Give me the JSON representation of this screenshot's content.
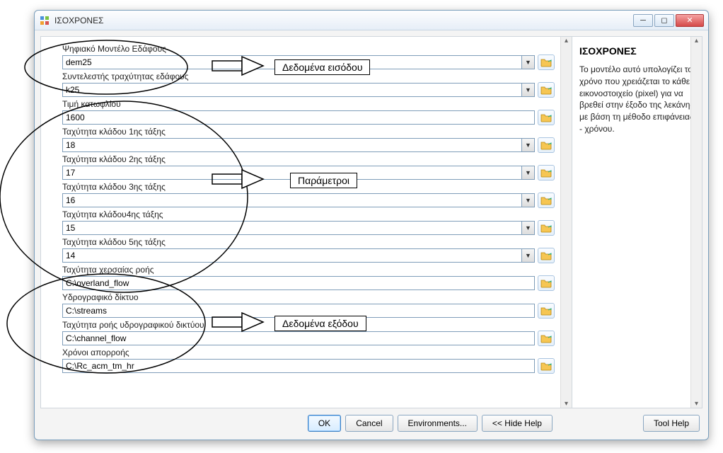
{
  "window": {
    "title": "ΙΣΟΧΡΟΝΕΣ"
  },
  "fields": [
    {
      "label": "Ψηφιακό Μοντέλο Εδάφους",
      "value": "dem25",
      "combo": true
    },
    {
      "label": "Συντελεστής τραχύτητας εδάφους",
      "value": "k25",
      "combo": true
    },
    {
      "label": "Τιμή κατωφλίου",
      "value": "1600",
      "combo": false
    },
    {
      "label": "Ταχύτητα κλάδου 1ης τάξης",
      "value": "18",
      "combo": true
    },
    {
      "label": "Ταχύτητα κλάδου 2ης τάξης",
      "value": "17",
      "combo": true
    },
    {
      "label": "Ταχύτητα κλάδου 3ης τάξης",
      "value": "16",
      "combo": true
    },
    {
      "label": "Ταχύτητα κλάδου4ης τάξης",
      "value": "15",
      "combo": true
    },
    {
      "label": "Ταχύτητα κλάδου 5ης τάξης",
      "value": "14",
      "combo": true
    },
    {
      "label": "Ταχύτητα χερσαίας ροής",
      "value": "C:\\overland_flow",
      "combo": false
    },
    {
      "label": "Υδρογραφικό δίκτυο",
      "value": "C:\\streams",
      "combo": false
    },
    {
      "label": "Ταχύτητα ροής υδρογραφικού δικτύου",
      "value": "C:\\channel_flow",
      "combo": false
    },
    {
      "label": "Χρόνοι απορροής",
      "value": "C:\\Rc_acm_tm_hr",
      "combo": false
    }
  ],
  "help": {
    "title": "ΙΣΟΧΡΟΝΕΣ",
    "body": "Το μοντέλο αυτό υπολογίζει το χρόνο που χρειάζεται το κάθε εικονοστοιχείο (pixel) για να βρεθεί στην έξοδο της λεκάνης με βάση τη μέθοδο επιφάνειας - χρόνου."
  },
  "buttons": {
    "ok": "OK",
    "cancel": "Cancel",
    "environments": "Environments...",
    "hidehelp": "<< Hide Help",
    "toolhelp": "Tool Help"
  },
  "annotations": {
    "input": "Δεδομένα εισόδου",
    "params": "Παράμετροι",
    "output": "Δεδομένα εξόδου"
  }
}
